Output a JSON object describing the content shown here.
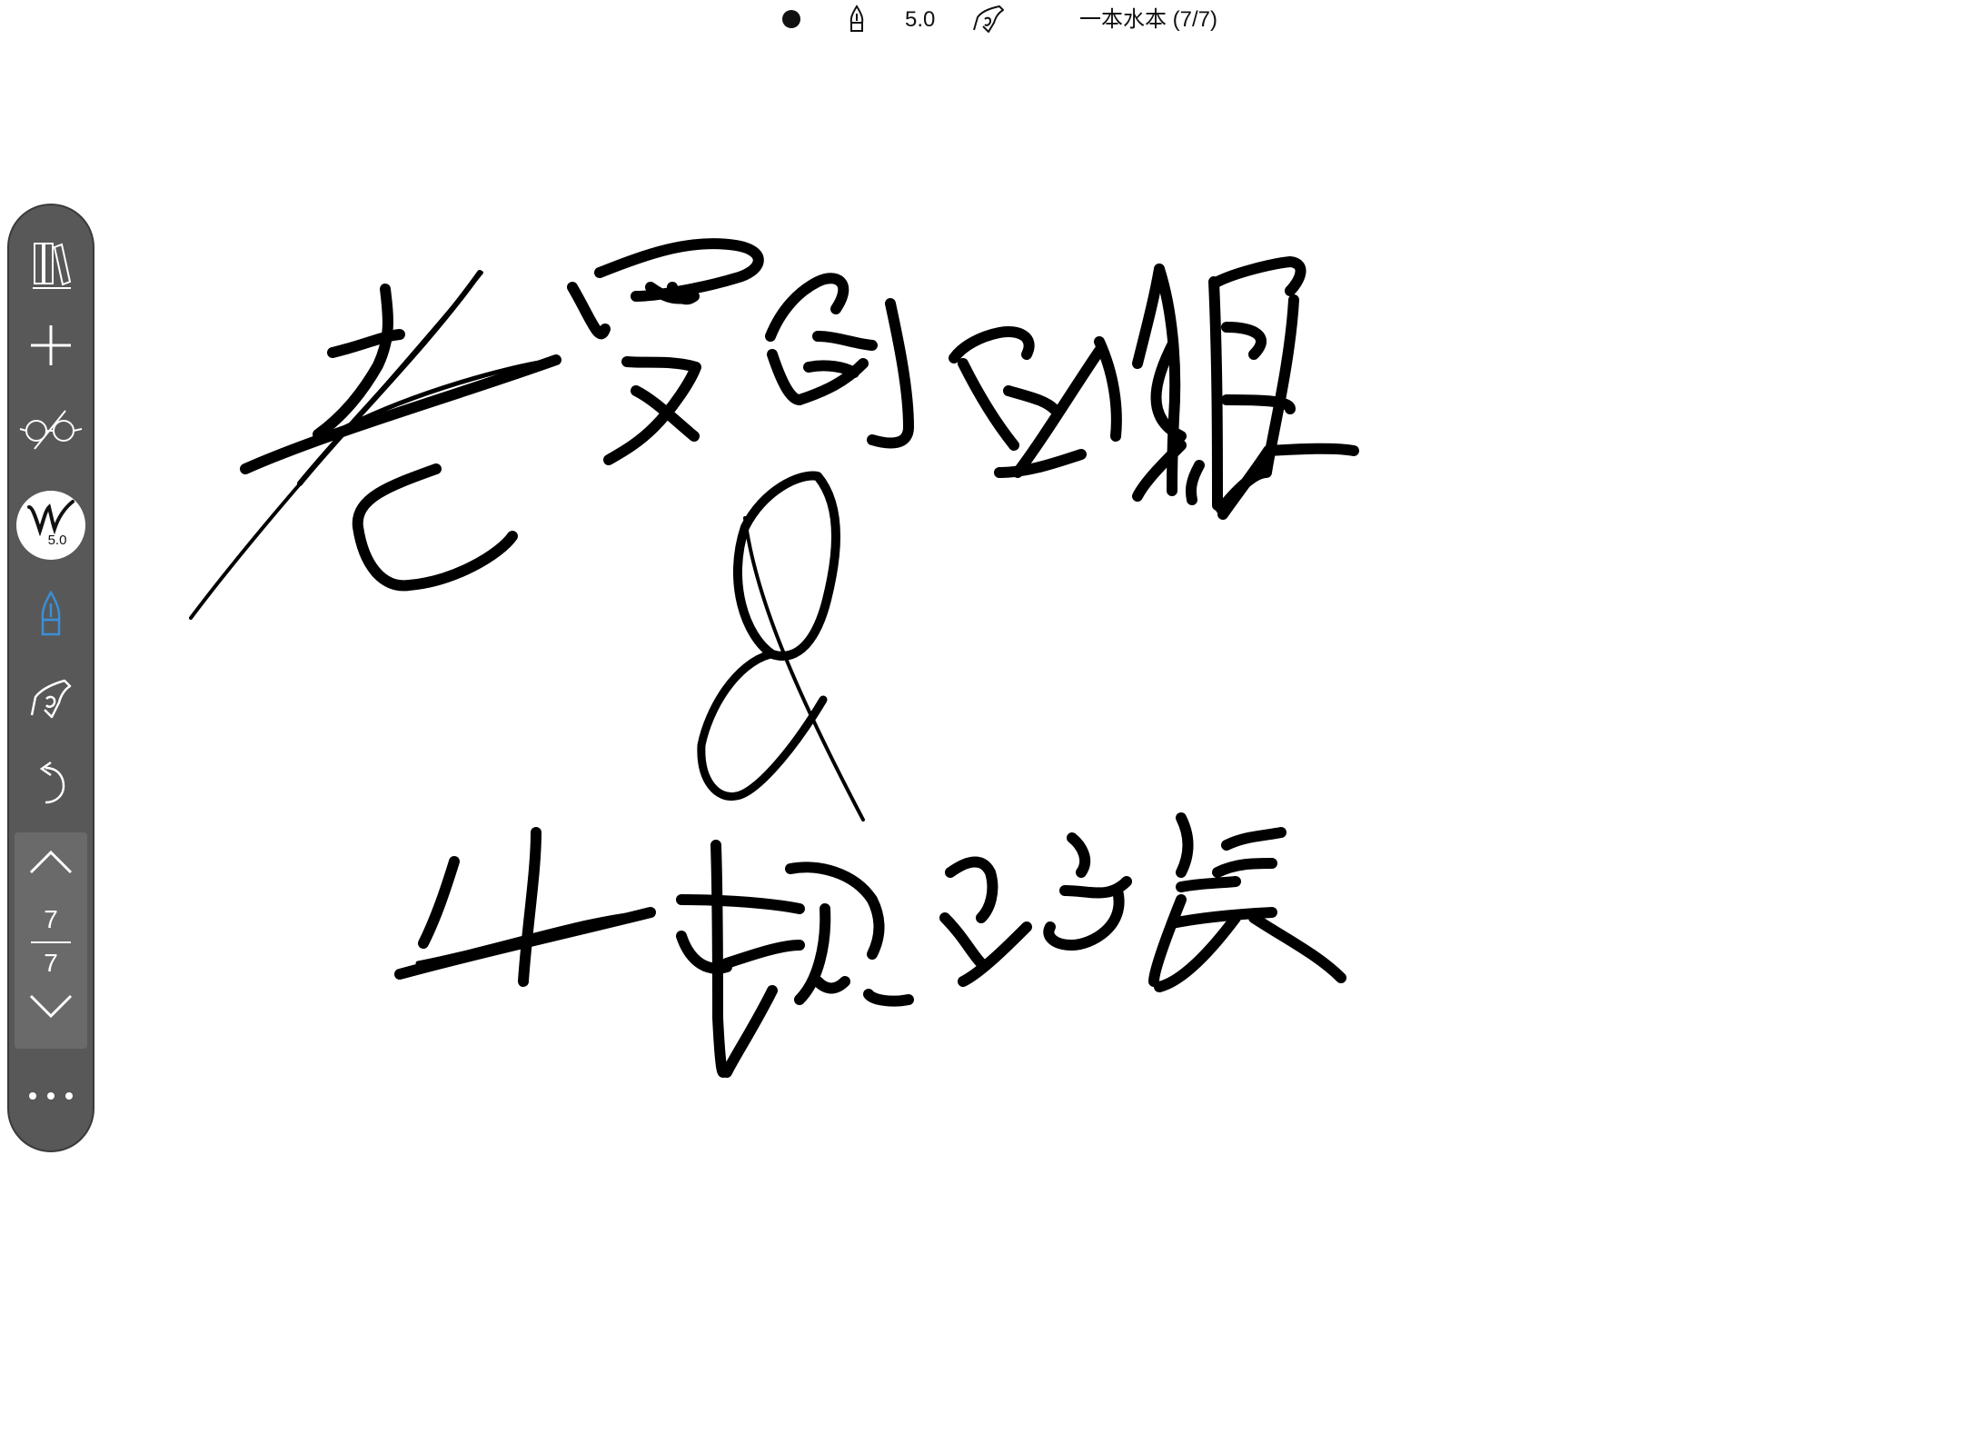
{
  "topbar": {
    "brush_size": "5.0",
    "notebook_title": "一本水本 (7/7)",
    "icons": [
      "color-dot",
      "pen-icon",
      "palm-rejection-icon"
    ]
  },
  "toolbar": {
    "icons": [
      "library-icon",
      "add-page-icon",
      "glasses-icon",
      "brush-icon",
      "pen-tip-icon",
      "hand-icon",
      "undo-icon",
      "chevron-up-icon",
      "chevron-down-icon",
      "more-icon"
    ],
    "brush_size": "5.0",
    "current_page": "7",
    "total_pages": "7",
    "active_tool_color": "#3a8fd8"
  },
  "colors": {
    "ink": "#000000",
    "rail_bg": "#585858",
    "pager_bg": "#6a6a6a"
  }
}
